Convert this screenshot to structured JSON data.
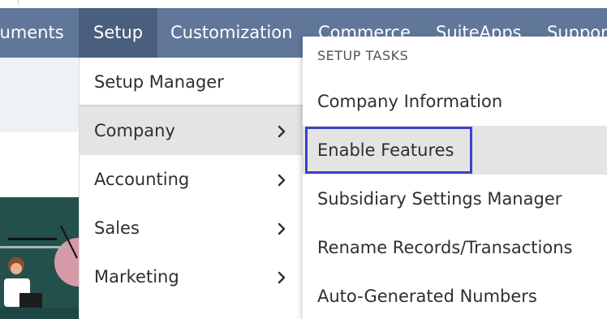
{
  "nav": {
    "items": [
      {
        "label": "cuments"
      },
      {
        "label": "Setup"
      },
      {
        "label": "Customization"
      },
      {
        "label": "Commerce"
      },
      {
        "label": "SuiteApps"
      },
      {
        "label": "Support"
      }
    ]
  },
  "setup_menu": {
    "items": [
      {
        "label": "Setup Manager"
      },
      {
        "label": "Company"
      },
      {
        "label": "Accounting"
      },
      {
        "label": "Sales"
      },
      {
        "label": "Marketing"
      }
    ]
  },
  "company_submenu": {
    "heading": "SETUP TASKS",
    "items": [
      {
        "label": "Company Information"
      },
      {
        "label": "Enable Features"
      },
      {
        "label": "Subsidiary Settings Manager"
      },
      {
        "label": "Rename Records/Transactions"
      },
      {
        "label": "Auto-Generated Numbers"
      }
    ]
  },
  "colors": {
    "navbar": "#607799",
    "navbar_active": "#4a5e7e",
    "menu_highlight": "#e4e4e4",
    "focus_outline": "#3a43c9"
  },
  "icons": {
    "submenu_arrow": "chevron-right-icon"
  }
}
